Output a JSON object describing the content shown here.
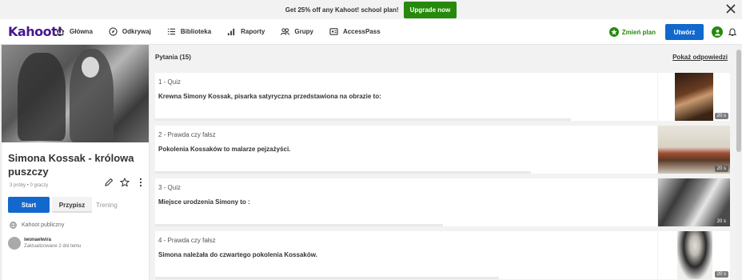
{
  "promo": {
    "text": "Get 25% off any Kahoot! school plan!",
    "button": "Upgrade now"
  },
  "nav": {
    "logo": "Kahoot!",
    "items": [
      {
        "label": "Główna",
        "icon": "home-icon"
      },
      {
        "label": "Odkrywaj",
        "icon": "compass-icon"
      },
      {
        "label": "Biblioteka",
        "icon": "list-icon"
      },
      {
        "label": "Raporty",
        "icon": "chart-icon"
      },
      {
        "label": "Grupy",
        "icon": "group-icon"
      },
      {
        "label": "AccessPass",
        "icon": "pass-icon"
      }
    ],
    "change_plan": "Zmień plan",
    "create": "Utwórz"
  },
  "kahoot": {
    "title": "Simona Kossak - królowa puszczy",
    "meta": "3 próby • 0 graczy",
    "start": "Start",
    "assign": "Przypisz",
    "training": "Trening",
    "visibility": "Kahoot publiczny",
    "author": "iwonaelwira",
    "updated": "Zaktualizowane 2 dni temu"
  },
  "questions": {
    "header": "Pytania (15)",
    "show_answers": "Pokaż odpowiedzi",
    "items": [
      {
        "type": "1 - Quiz",
        "text": "Krewna Simony Kossak, pisarka satyryczna przedstawiona na obrazie to:",
        "time": "20 s"
      },
      {
        "type": "2 - Prawda czy fałsz",
        "text": "Pokolenia Kossaków to malarze pejzażyści.",
        "time": "20 s"
      },
      {
        "type": "3 - Quiz",
        "text": "Miejsce urodzenia Simony to :",
        "time": "20 s"
      },
      {
        "type": "4 - Prawda czy fałsz",
        "text": "Simona należała do czwartego pokolenia Kossaków.",
        "time": "20 s"
      }
    ]
  },
  "colors": {
    "purple": "#46178f",
    "blue": "#1368ce",
    "green": "#26890c"
  }
}
